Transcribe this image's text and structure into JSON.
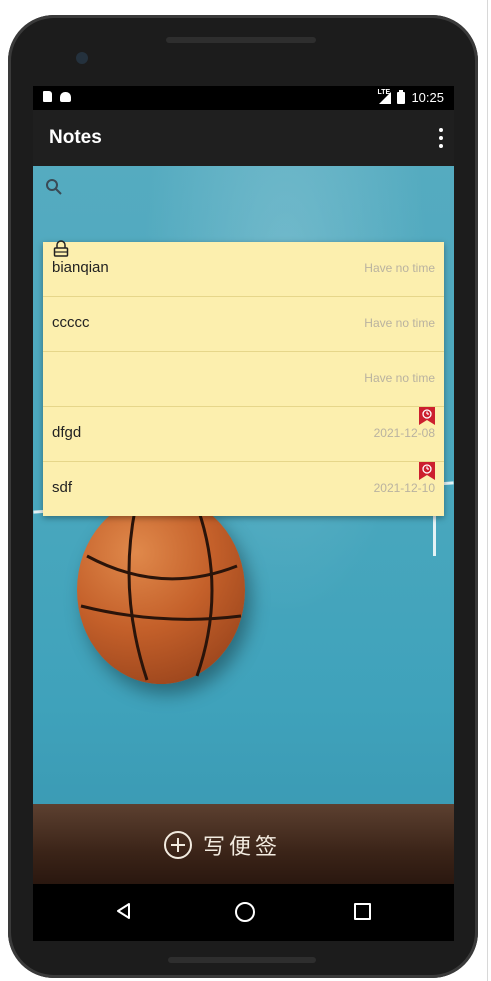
{
  "app": {
    "title": "Notes"
  },
  "status": {
    "time": "10:25",
    "network": "LTE"
  },
  "notes": [
    {
      "title": "bianqian",
      "date": "Have no time",
      "locked": true,
      "alarm": false
    },
    {
      "title": "ccccc",
      "date": "Have no time",
      "locked": false,
      "alarm": false
    },
    {
      "title": "",
      "date": "Have no time",
      "locked": false,
      "alarm": false
    },
    {
      "title": "dfgd",
      "date": "2021-12-08",
      "locked": false,
      "alarm": true
    },
    {
      "title": "sdf",
      "date": "2021-12-10",
      "locked": false,
      "alarm": true
    }
  ],
  "bottom": {
    "write_label": "写便签"
  },
  "colors": {
    "note_bg": "#fcefae",
    "appbar": "#1f1f1f",
    "alarm": "#cc1f2e"
  }
}
